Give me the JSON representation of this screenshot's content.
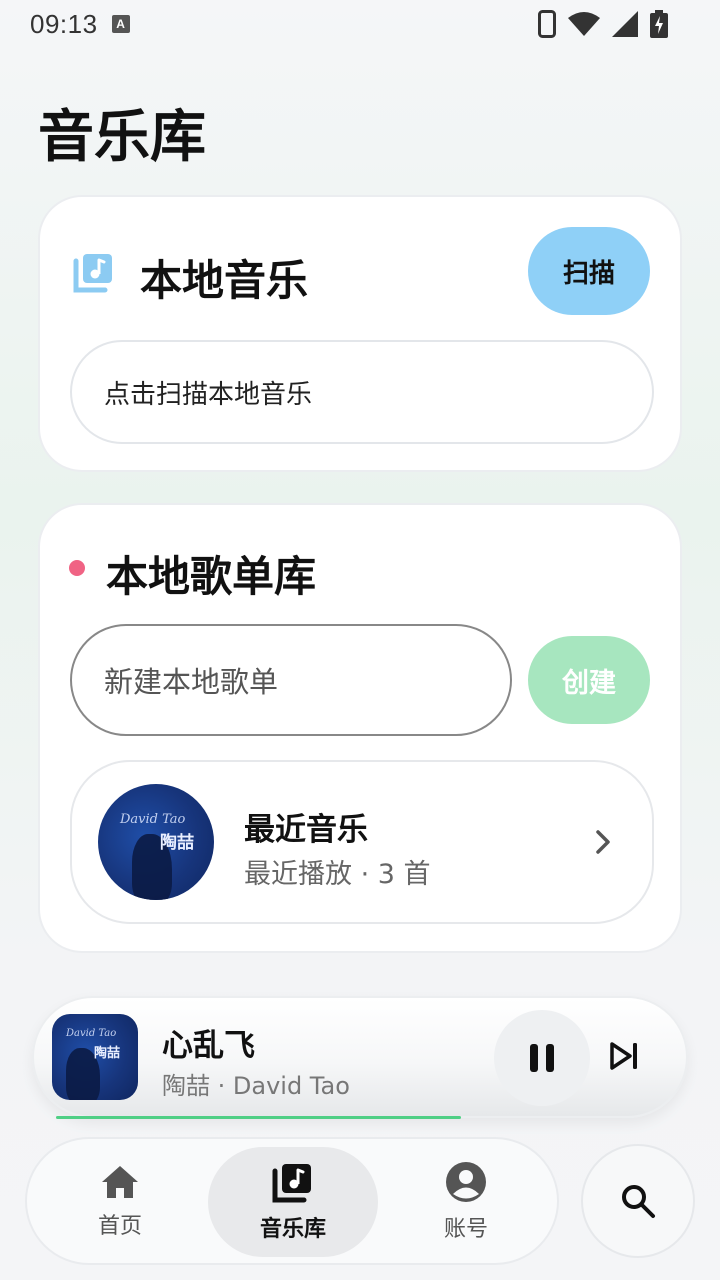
{
  "status_bar": {
    "time": "09:13",
    "ime_badge": "A"
  },
  "page": {
    "title": "音乐库"
  },
  "local_music": {
    "icon": "music-library-icon",
    "title": "本地音乐",
    "scan_label": "扫描",
    "hint": "点击扫描本地音乐"
  },
  "playlists": {
    "title": "本地歌单库",
    "new_placeholder": "新建本地歌单",
    "create_label": "创建",
    "items": [
      {
        "title": "最近音乐",
        "subtitle": "最近播放 · 3 首",
        "cover_text": "David Tao",
        "cover_cjk": "陶喆"
      }
    ]
  },
  "now_playing": {
    "title": "心乱飞",
    "artist": "陶喆 · David Tao",
    "cover_text": "David Tao",
    "cover_cjk": "陶喆",
    "progress": 0.67,
    "state": "playing"
  },
  "bottom_nav": {
    "items": [
      {
        "label": "首页",
        "icon": "home-icon"
      },
      {
        "label": "音乐库",
        "icon": "music-library-icon",
        "active": true
      },
      {
        "label": "账号",
        "icon": "account-icon"
      }
    ]
  },
  "colors": {
    "scan_button": "#8fd0f7",
    "create_button": "#a7e6bf",
    "accent_dot": "#f06384",
    "progress": "#4fcf85"
  }
}
